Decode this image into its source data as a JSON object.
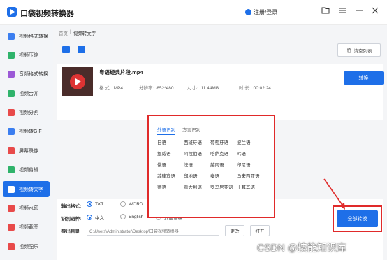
{
  "app": {
    "title": "口袋视频转换器",
    "login": "注册/登录"
  },
  "sidebar": {
    "items": [
      {
        "label": "视频格式转换",
        "color": "#3b7ef0"
      },
      {
        "label": "视频压缩",
        "color": "#2fb36b"
      },
      {
        "label": "音频格式转换",
        "color": "#9b59d6"
      },
      {
        "label": "视频合并",
        "color": "#2fb36b"
      },
      {
        "label": "视频分割",
        "color": "#e84a4a"
      },
      {
        "label": "视频转GIF",
        "color": "#3b7ef0"
      },
      {
        "label": "屏幕录像",
        "color": "#e84a4a"
      },
      {
        "label": "视频剪辑",
        "color": "#2fb36b"
      },
      {
        "label": "视频转文字",
        "color": "#ffffff"
      },
      {
        "label": "视频水印",
        "color": "#e84a4a"
      },
      {
        "label": "视频截图",
        "color": "#e84a4a"
      },
      {
        "label": "视频配乐",
        "color": "#e84a4a"
      }
    ]
  },
  "breadcrumb": {
    "home": "首页",
    "sep": "|",
    "current": "视频转文字"
  },
  "toolbar": {
    "clear_label": "清空列表",
    "trash_icon": "trash-icon"
  },
  "file": {
    "name": "粤语经典片段.mp4",
    "format_key": "格 式:",
    "format_val": "MP4",
    "res_key": "分辨率:",
    "res_val": "852*480",
    "size_key": "大 小:",
    "size_val": "11.44MB",
    "dur_key": "时 长:",
    "dur_val": "00:02:24",
    "convert_label": "转换"
  },
  "lang_panel": {
    "tabs": [
      "外语识别",
      "方言识别"
    ],
    "languages": [
      "日语",
      "西班牙语",
      "葡萄牙语",
      "波兰语",
      "挪威语",
      "阿拉伯语",
      "哈萨克语",
      "韩语",
      "俄语",
      "法语",
      "越南语",
      "印尼语",
      "菲律宾语",
      "印地语",
      "泰语",
      "马来西亚语",
      "德语",
      "意大利语",
      "罗马尼亚语",
      "土耳其语"
    ]
  },
  "settings": {
    "output_format_label": "输出格式:",
    "format_options": [
      "TXT",
      "WORD"
    ],
    "lang_label": "识别语种:",
    "lang_options": [
      "中文",
      "English",
      "其他语种"
    ],
    "dir_label": "导出目录",
    "dir_value": "C:\\Users\\Administrator\\Desktop\\口袋视频转换器",
    "change_label": "更改",
    "open_label": "打开",
    "convert_all_label": "全部转换"
  },
  "watermark": "CSDN @技能知识库"
}
